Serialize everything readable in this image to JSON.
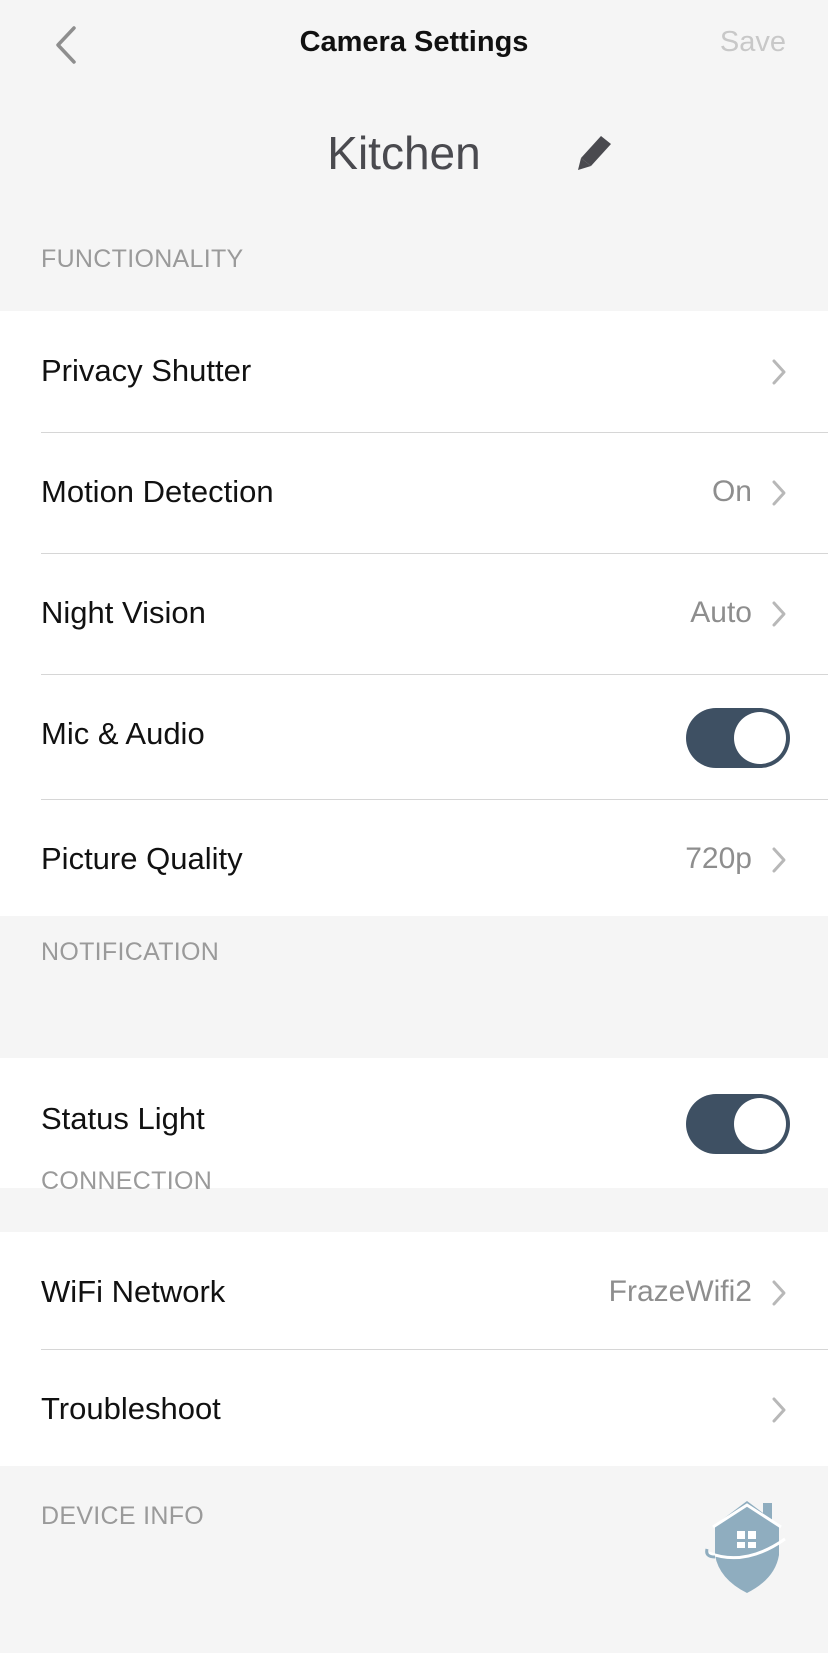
{
  "nav": {
    "title": "Camera Settings",
    "save_label": "Save",
    "back_icon": "chevron-left-icon"
  },
  "device": {
    "name": "Kitchen",
    "edit_icon": "pencil-icon"
  },
  "sections": {
    "functionality": {
      "header": "FUNCTIONALITY",
      "rows": [
        {
          "label": "Privacy Shutter",
          "value": "",
          "type": "link"
        },
        {
          "label": "Motion Detection",
          "value": "On",
          "type": "link"
        },
        {
          "label": "Night Vision",
          "value": "Auto",
          "type": "link"
        },
        {
          "label": "Mic & Audio",
          "type": "toggle",
          "on": true
        },
        {
          "label": "Picture Quality",
          "value": "720p",
          "type": "link"
        }
      ]
    },
    "notification": {
      "header": "NOTIFICATION",
      "rows": [
        {
          "label": "Status Light",
          "type": "toggle",
          "on": true
        }
      ]
    },
    "connection": {
      "header": "CONNECTION",
      "rows": [
        {
          "label": "WiFi Network",
          "value": "FrazeWifi2",
          "type": "link"
        },
        {
          "label": "Troubleshoot",
          "value": "",
          "type": "link"
        }
      ]
    },
    "device_info": {
      "header": "DEVICE INFO"
    }
  },
  "colors": {
    "toggle_on": "#3e5063",
    "background": "#f5f5f5",
    "watermark": "#8fadbf"
  },
  "watermark_icon": "house-shield-logo-icon"
}
